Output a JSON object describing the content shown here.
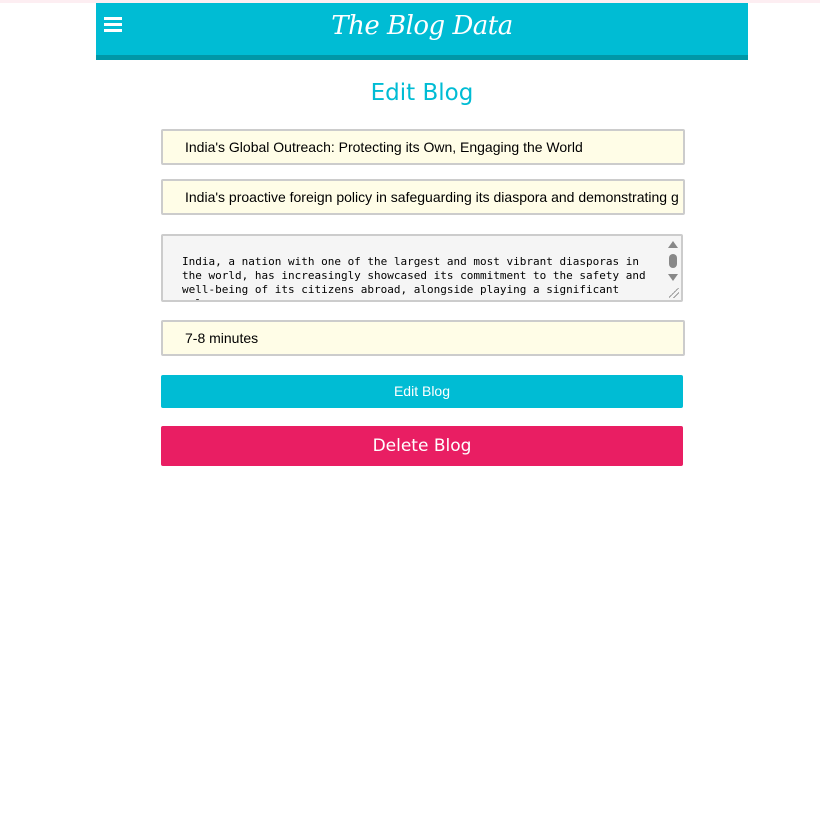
{
  "header": {
    "brand": "The Blog Data",
    "menu_icon": "hamburger-menu-icon",
    "color": "#00bcd4"
  },
  "page": {
    "title": "Edit Blog"
  },
  "form": {
    "title_value": "India's Global Outreach: Protecting its Own, Engaging the World",
    "description_value": "India's proactive foreign policy in safeguarding its diaspora and demonstrating g",
    "content_value": "India, a nation with one of the largest and most vibrant diasporas in\nthe world, has increasingly showcased its commitment to the safety and\nwell-being of its citizens abroad, alongside playing a significant role\nin global humanitarian efforts. This dual focus underscores India's",
    "read_time_value": "7-8 minutes"
  },
  "buttons": {
    "edit_label": "Edit Blog",
    "delete_label": "Delete Blog",
    "edit_color": "#00bcd4",
    "delete_color": "#e91e63"
  }
}
